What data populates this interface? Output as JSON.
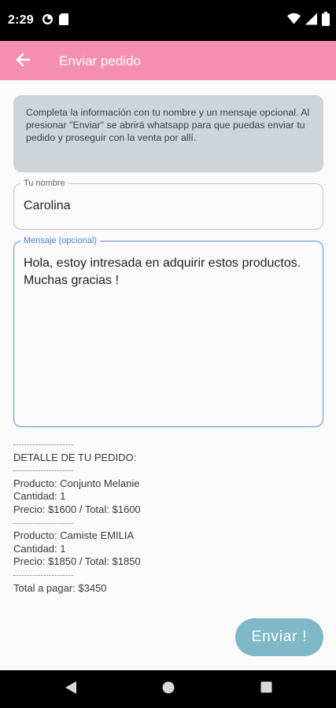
{
  "status_bar": {
    "time": "2:29"
  },
  "app_bar": {
    "title": "Enviar pedido",
    "color": "#f48fb1"
  },
  "info": {
    "text": "Completa la información con tu nombre y un mensaje opcional. Al presionar \"Enviar\" se abrirá whatsapp para que puedas enviar tu pedido y proseguir con la venta por allí."
  },
  "form": {
    "name_label": "Tu nombre",
    "name_value": "Carolina",
    "message_label": "Mensaje (opcional)",
    "message_value": "Hola, estoy intresada en adquirir estos productos. Muchas gracias !"
  },
  "order": {
    "heading": "DETALLE DE TU PEDIDO:",
    "items": [
      {
        "product": "Producto: Conjunto Melanie",
        "quantity": "Cantidad: 1",
        "price": "Precio: $1600 / Total: $1600"
      },
      {
        "product": "Producto: Camiste EMILIA",
        "quantity": "Cantidad: 1",
        "price": "Precio: $1850 / Total: $1850"
      }
    ],
    "total": "Total a pagar: $3450"
  },
  "actions": {
    "send_label": "Enviar !",
    "send_color": "#7fb9c8"
  }
}
